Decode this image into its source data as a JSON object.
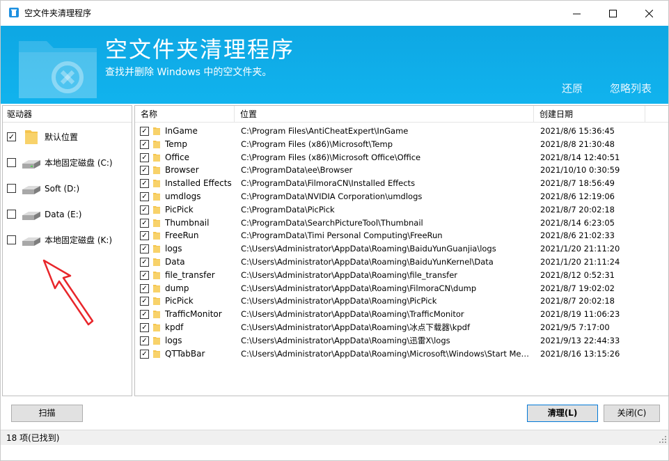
{
  "window": {
    "title": "空文件夹清理程序"
  },
  "banner": {
    "title": "空文件夹清理程序",
    "subtitle": "查找并删除 Windows 中的空文件夹。",
    "restore_label": "还原",
    "ignore_list_label": "忽略列表"
  },
  "drives": {
    "header": "驱动器",
    "items": [
      {
        "label": "默认位置",
        "checked": true,
        "icon": "folder-icon"
      },
      {
        "label": "本地固定磁盘 (C:)",
        "checked": false,
        "icon": "drive-icon"
      },
      {
        "label": "Soft (D:)",
        "checked": false,
        "icon": "drive-icon"
      },
      {
        "label": "Data (E:)",
        "checked": false,
        "icon": "drive-icon"
      },
      {
        "label": "本地固定磁盘 (K:)",
        "checked": false,
        "icon": "drive-icon"
      }
    ]
  },
  "list": {
    "columns": {
      "name": "名称",
      "path": "位置",
      "date": "创建日期"
    },
    "rows": [
      {
        "name": "InGame",
        "path": "C:\\Program Files\\AntiCheatExpert\\InGame",
        "date": "2021/8/6 15:36:45"
      },
      {
        "name": "Temp",
        "path": "C:\\Program Files (x86)\\Microsoft\\Temp",
        "date": "2021/8/8 21:30:48"
      },
      {
        "name": "Office",
        "path": "C:\\Program Files (x86)\\Microsoft Office\\Office",
        "date": "2021/8/14 12:40:51"
      },
      {
        "name": "Browser",
        "path": "C:\\ProgramData\\ee\\Browser",
        "date": "2021/10/10 0:30:59"
      },
      {
        "name": "Installed Effects",
        "path": "C:\\ProgramData\\FilmoraCN\\Installed Effects",
        "date": "2021/8/7 18:56:49"
      },
      {
        "name": "umdlogs",
        "path": "C:\\ProgramData\\NVIDIA Corporation\\umdlogs",
        "date": "2021/8/6 12:19:06"
      },
      {
        "name": "PicPick",
        "path": "C:\\ProgramData\\PicPick",
        "date": "2021/8/7 20:02:18"
      },
      {
        "name": "Thumbnail",
        "path": "C:\\ProgramData\\SearchPictureTool\\Thumbnail",
        "date": "2021/8/14 6:23:05"
      },
      {
        "name": "FreeRun",
        "path": "C:\\ProgramData\\Timi Personal Computing\\FreeRun",
        "date": "2021/8/6 21:02:33"
      },
      {
        "name": "logs",
        "path": "C:\\Users\\Administrator\\AppData\\Roaming\\BaiduYunGuanjia\\logs",
        "date": "2021/1/20 21:11:20"
      },
      {
        "name": "Data",
        "path": "C:\\Users\\Administrator\\AppData\\Roaming\\BaiduYunKernel\\Data",
        "date": "2021/1/20 21:11:24"
      },
      {
        "name": "file_transfer",
        "path": "C:\\Users\\Administrator\\AppData\\Roaming\\file_transfer",
        "date": "2021/8/12 0:52:31"
      },
      {
        "name": "dump",
        "path": "C:\\Users\\Administrator\\AppData\\Roaming\\FilmoraCN\\dump",
        "date": "2021/8/7 19:02:02"
      },
      {
        "name": "PicPick",
        "path": "C:\\Users\\Administrator\\AppData\\Roaming\\PicPick",
        "date": "2021/8/7 20:02:18"
      },
      {
        "name": "TrafficMonitor",
        "path": "C:\\Users\\Administrator\\AppData\\Roaming\\TrafficMonitor",
        "date": "2021/8/19 11:06:23"
      },
      {
        "name": "kpdf",
        "path": "C:\\Users\\Administrator\\AppData\\Roaming\\冰点下载器\\kpdf",
        "date": "2021/9/5 7:17:00"
      },
      {
        "name": "logs",
        "path": "C:\\Users\\Administrator\\AppData\\Roaming\\迅雷X\\logs",
        "date": "2021/9/13 22:44:33"
      },
      {
        "name": "QTTabBar",
        "path": "C:\\Users\\Administrator\\AppData\\Roaming\\Microsoft\\Windows\\Start Menu\\P...",
        "date": "2021/8/16 13:15:26"
      }
    ]
  },
  "buttons": {
    "scan": "扫描",
    "clean": "清理(L)",
    "close": "关闭(C)"
  },
  "status": {
    "text": "18 项(已找到)"
  },
  "colors": {
    "banner": "#11b3ee",
    "folder": "#f5c54e",
    "annotation": "#e8262b"
  }
}
